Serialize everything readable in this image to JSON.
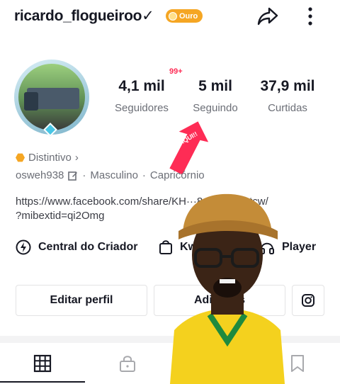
{
  "header": {
    "username": "ricardo_flogueiroo✓",
    "badge_label": "Ouro"
  },
  "stats": [
    {
      "value": "4,1 mil",
      "label": "Seguidores"
    },
    {
      "value": "5 mil",
      "label": "Seguindo"
    },
    {
      "value": "37,9 mil",
      "label": "Curtidas"
    }
  ],
  "notification_badge": "99+",
  "arrow_text": "AQUI!!",
  "profile": {
    "distintivo": "Distintivo",
    "nickname": "osweh938",
    "separator": "·",
    "gender": "Masculino",
    "sign": "Capricórnio",
    "link_line1": "https://www.facebook.com/share/KH···8ep8oVcxxtcw/",
    "link_line2": "?mibextid=qi2Omg"
  },
  "actions": [
    {
      "label": "Central do Criador",
      "icon": "lightning-icon"
    },
    {
      "label": "Kw",
      "icon": "bag-icon"
    },
    {
      "label": "Player",
      "icon": "headphones-icon"
    }
  ],
  "buttons": {
    "edit_profile": "Editar perfil",
    "add_friends": "Adici        gos"
  },
  "tabs": [
    {
      "icon": "grid-icon",
      "active": true
    },
    {
      "icon": "lock-icon",
      "active": false
    },
    {
      "icon": "repost-icon",
      "active": false
    },
    {
      "icon": "bookmark-icon",
      "active": false
    }
  ],
  "colors": {
    "accent": "#fe2c55",
    "gold": "#f5a623",
    "secondary_text": "#6b6e76"
  }
}
